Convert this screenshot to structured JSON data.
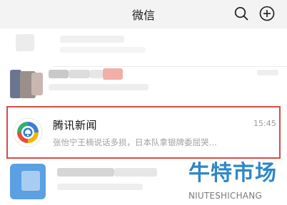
{
  "header": {
    "title": "微信",
    "search_icon": "search-icon",
    "add_icon": "plus-circle-icon"
  },
  "chats": [
    {
      "name": "腾讯新闻",
      "preview": "张怡宁王楠说话多损，日本队拿银牌委屈哭…",
      "time": "15:45",
      "avatar_icon": "tencent-news-logo"
    }
  ],
  "watermark": {
    "chinese": "牛特市场",
    "english": "NIUTESHICHANG"
  },
  "colors": {
    "highlight": "#d94a44",
    "header_bg": "#f3f3f3",
    "watermark": "#2f87c6"
  }
}
